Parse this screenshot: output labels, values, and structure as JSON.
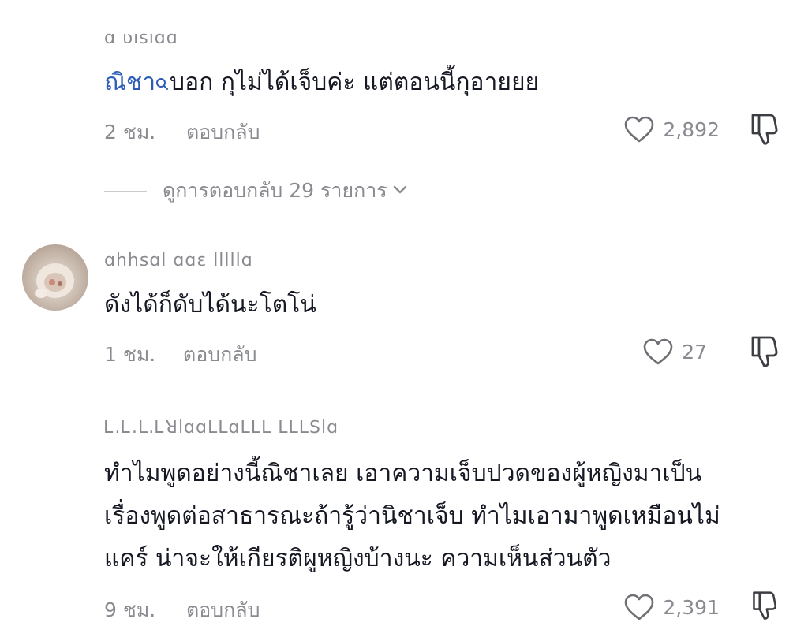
{
  "comments": [
    {
      "username": "ɑ ʋısıɑɑ",
      "mention": "ณิชา",
      "text": "บอก กุไม่ได้เจ็บค่ะ แต่ตอนนี้กุอายยย",
      "time": "2 ชม.",
      "reply_label": "ตอบกลับ",
      "likes": "2,892"
    },
    {
      "username": "ɑhhsɑl ɑɑɛ lllllɑ",
      "text": "ดังได้ก็ดับได้นะโตโน่",
      "time": "1 ชม.",
      "reply_label": "ตอบกลับ",
      "likes": "27"
    },
    {
      "username": "Ꮮ.Ꮮ.ꓡ.Ꮮꓤlɑɑꓡꓡɑꓡꓡꓡ ꓡꓡꓡꓢlɑ",
      "lines": [
        "ทำไมพูดอย่างนี้ณิชาเลย เอาความเจ็บปวดของผู้หญิงมาเป็น",
        "เรื่องพูดต่อสาธารณะถ้ารู้ว่านิชาเจ็บ ทำไมเอามาพูดเหมือนไม่",
        "แคร์ น่าจะให้เกียรติผูหญิงบ้างนะ ความเห็นส่วนตัว"
      ],
      "time": "9 ชม.",
      "reply_label": "ตอบกลับ",
      "likes": "2,391"
    }
  ],
  "view_replies": {
    "label": "ดูการตอบกลับ 29 รายการ"
  },
  "colors": {
    "text": "#161823",
    "meta": "#8a8b91",
    "mention": "#2b5db8",
    "divider": "#c9cacd"
  }
}
